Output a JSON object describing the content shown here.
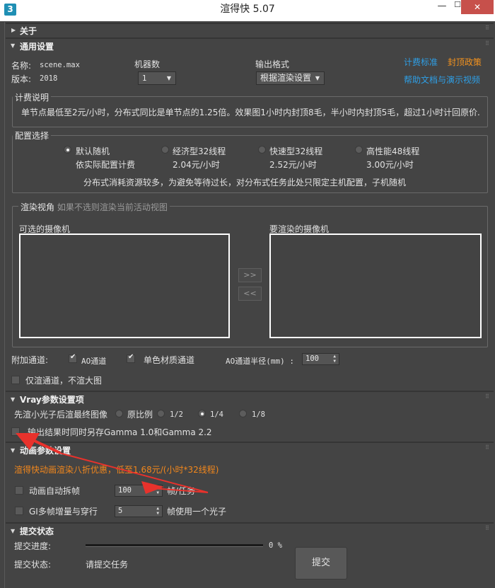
{
  "window": {
    "icon_text": "3",
    "title": "渲得快 5.07",
    "minimize": "—",
    "maximize": "☐",
    "close": "✕"
  },
  "about": {
    "title": "关于"
  },
  "general": {
    "title": "通用设置",
    "name_label": "名称:",
    "name_value": "scene.max",
    "version_label": "版本:",
    "version_value": "2018",
    "machines_label": "机器数",
    "machines_value": "1",
    "format_label": "输出格式",
    "format_value": "根据渲染设置",
    "link_billing": "计费标准",
    "link_capping": "封顶政策",
    "link_help": "帮助文档与演示视频",
    "billing_group": "计费说明",
    "billing_text": "单节点最低至2元/小时，分布式同比是单节点的1.25倍。效果图1小时内封顶8毛，半小时内封顶5毛，超过1小时计回原价.",
    "config_group": "配置选择",
    "configs": [
      {
        "name": "默认随机",
        "price": "依实际配置计费",
        "selected": true
      },
      {
        "name": "经济型32线程",
        "price": "2.04元/小时",
        "selected": false
      },
      {
        "name": "快速型32线程",
        "price": "2.52元/小时",
        "selected": false
      },
      {
        "name": "高性能48线程",
        "price": "3.00元/小时",
        "selected": false
      }
    ],
    "config_note": "分布式消耗资源较多，为避免等待过长，对分布式任务此处只限定主机配置，子机随机",
    "view_group": "渲染视角",
    "view_hint": "如果不选则渲染当前活动视图",
    "cams_available": "可选的摄像机",
    "cams_render": "要渲染的摄像机",
    "btn_add": ">>",
    "btn_remove": "<<",
    "extra_label": "附加通道:",
    "ao_label": "AO通道",
    "ao_checked": true,
    "mono_label": "单色材质通道",
    "mono_checked": true,
    "ao_radius_label": "AO通道半径(mm) :",
    "ao_radius_value": "100",
    "only_channels_label": "仅渲通道，不渲大图",
    "only_channels_checked": false
  },
  "vray": {
    "title": "Vray参数设置项",
    "prepass_label": "先渲小光子后渲最终图像",
    "options": [
      {
        "label": "原比例",
        "selected": false
      },
      {
        "label": "1/2",
        "selected": false
      },
      {
        "label": "1/4",
        "selected": true
      },
      {
        "label": "1/8",
        "selected": false
      }
    ],
    "gamma_label": "输出结果时同时另存Gamma 1.0和Gamma 2.2",
    "gamma_checked": false
  },
  "animation": {
    "title": "动画参数设置",
    "promo": "渲得快动画渲染八折优惠，低至1.68元/(小时*32线程)",
    "auto_split_label": "动画自动拆帧",
    "auto_split_checked": false,
    "auto_split_value": "100",
    "auto_split_unit": "帧/任务",
    "gi_label": "GI多帧增量与穿行",
    "gi_checked": false,
    "gi_value": "5",
    "gi_unit": "帧使用一个光子"
  },
  "submit": {
    "title": "提交状态",
    "progress_label": "提交进度:",
    "progress_value": "0 %",
    "progress_fraction": 0,
    "status_label": "提交状态:",
    "status_value": "请提交任务",
    "button": "提交"
  },
  "colors": {
    "panel": "#444444",
    "link_blue": "#2e9fe6",
    "link_orange": "#f5931e",
    "annotation_red": "#e8322c"
  }
}
